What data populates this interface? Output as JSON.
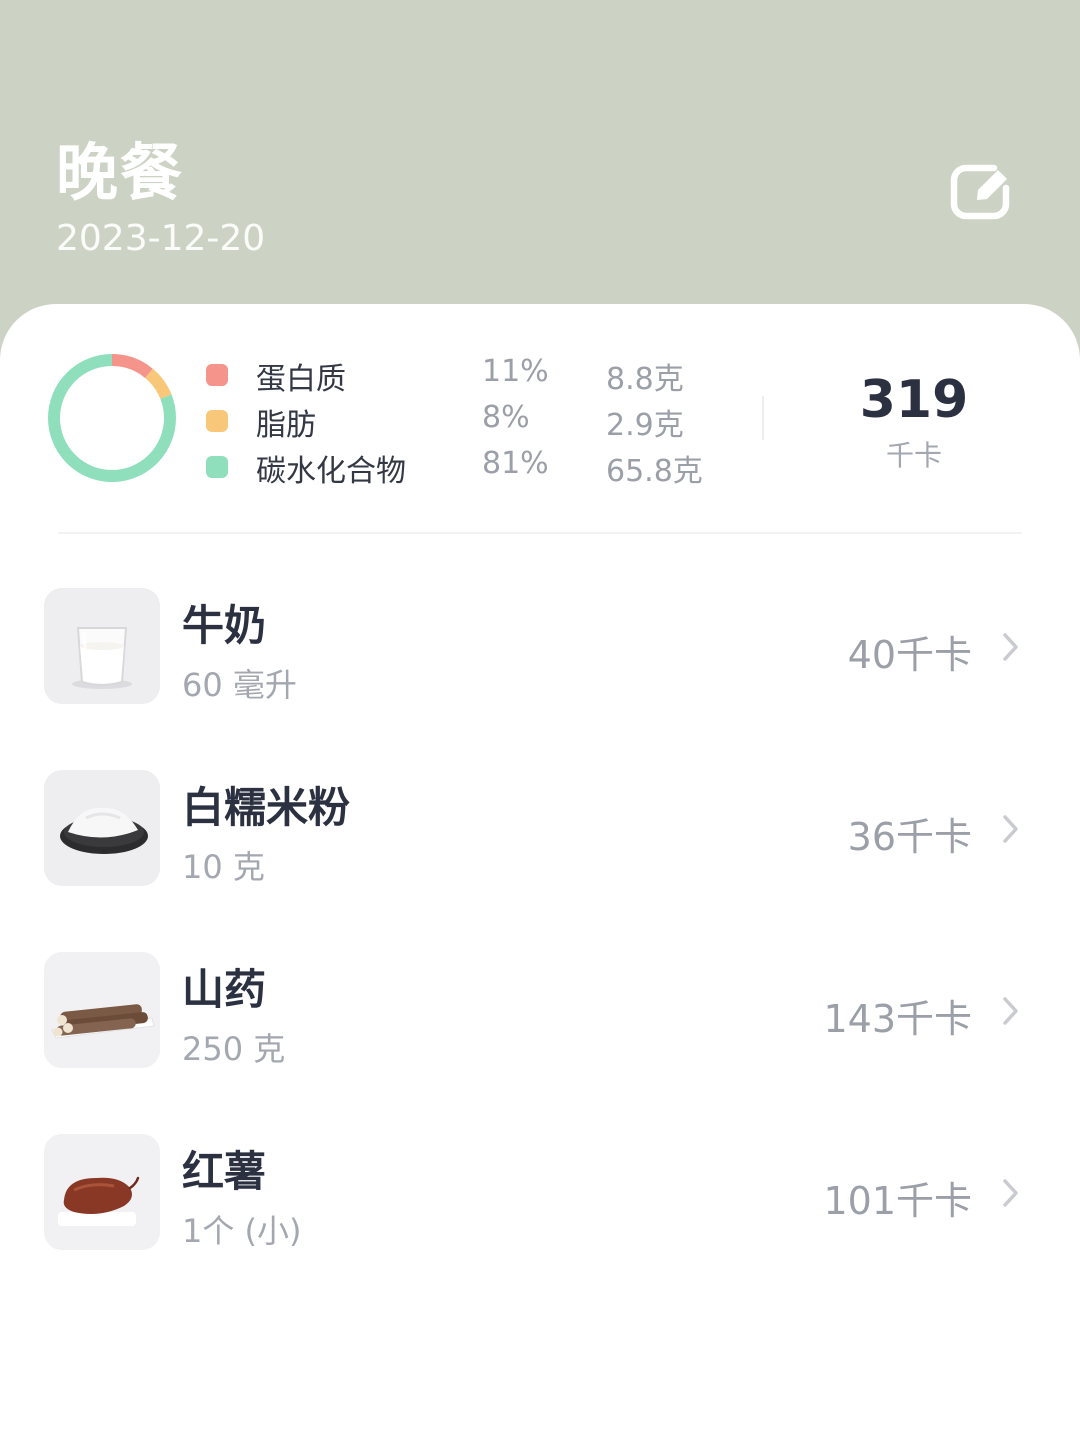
{
  "header": {
    "title": "晚餐",
    "date": "2023-12-20",
    "edit_icon": "edit-icon",
    "background_color": "#ccd3c4"
  },
  "summary": {
    "macros": [
      {
        "name": "蛋白质",
        "percent": "11%",
        "amount": "8.8克",
        "color": "#f4948a",
        "fraction": 0.11
      },
      {
        "name": "脂肪",
        "percent": "8%",
        "amount": "2.9克",
        "color": "#f8c77a",
        "fraction": 0.08
      },
      {
        "name": "碳水化合物",
        "percent": "81%",
        "amount": "65.8克",
        "color": "#8fdfbd",
        "fraction": 0.81
      }
    ],
    "total_kcal": "319",
    "kcal_unit": "千卡"
  },
  "foods": [
    {
      "name": "牛奶",
      "amount": "60 毫升",
      "kcal": "40千卡",
      "icon": "milk-glass-icon"
    },
    {
      "name": "白糯米粉",
      "amount": "10 克",
      "kcal": "36千卡",
      "icon": "rice-flour-icon"
    },
    {
      "name": "山药",
      "amount": "250 克",
      "kcal": "143千卡",
      "icon": "yam-icon"
    },
    {
      "name": "红薯",
      "amount": "1个 (小)",
      "kcal": "101千卡",
      "icon": "sweet-potato-icon"
    }
  ]
}
